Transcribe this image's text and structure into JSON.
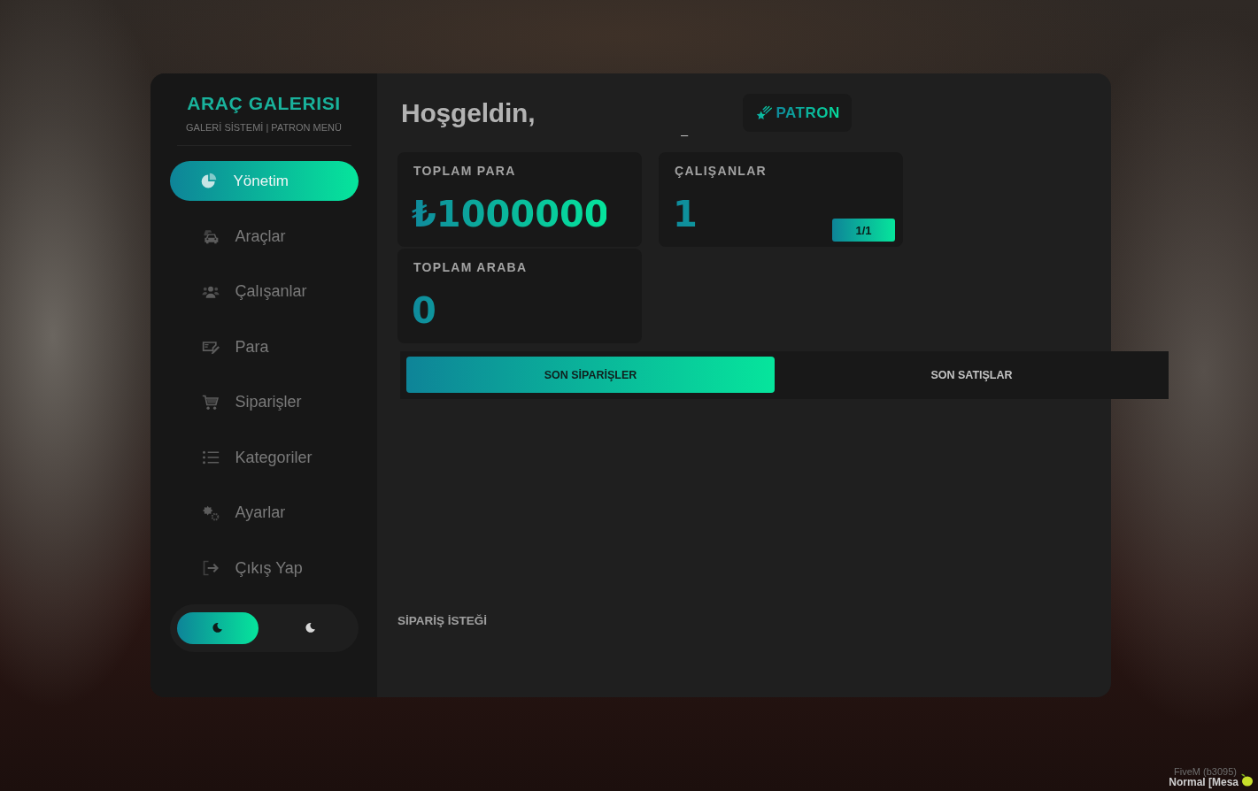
{
  "sidebar": {
    "title": "ARAÇ GALERISI",
    "subtitle": "GALERİ SİSTEMİ | PATRON MENÜ",
    "menu": [
      {
        "label": "Yönetim",
        "selected": true
      },
      {
        "label": "Araçlar",
        "selected": false
      },
      {
        "label": "Çalışanlar",
        "selected": false
      },
      {
        "label": "Para",
        "selected": false
      },
      {
        "label": "Siparişler",
        "selected": false
      },
      {
        "label": "Kategoriler",
        "selected": false
      },
      {
        "label": "Ayarlar",
        "selected": false
      },
      {
        "label": "Çıkış Yap",
        "selected": false
      }
    ],
    "theme_toggle": [
      {
        "selected": true
      },
      {
        "selected": false
      }
    ]
  },
  "header": {
    "greeting": "Hoşgeldin,",
    "username": "_",
    "role_badge": "PATRON"
  },
  "stats": [
    {
      "label": "TOPLAM PARA",
      "value": "₺1000000"
    },
    {
      "label": "ÇALIŞANLAR",
      "value": "1",
      "badge": "1/1"
    },
    {
      "label": "TOPLAM ARABA",
      "value": "0"
    }
  ],
  "tabs": [
    {
      "label": "SON SİPARİŞLER",
      "selected": true
    },
    {
      "label": "SON SATIŞLAR",
      "selected": false
    }
  ],
  "section_title": "SİPARİŞ İSTEĞİ",
  "overlay": {
    "build": "FiveM (b3095)",
    "mode": "Normal [Mesa"
  }
}
